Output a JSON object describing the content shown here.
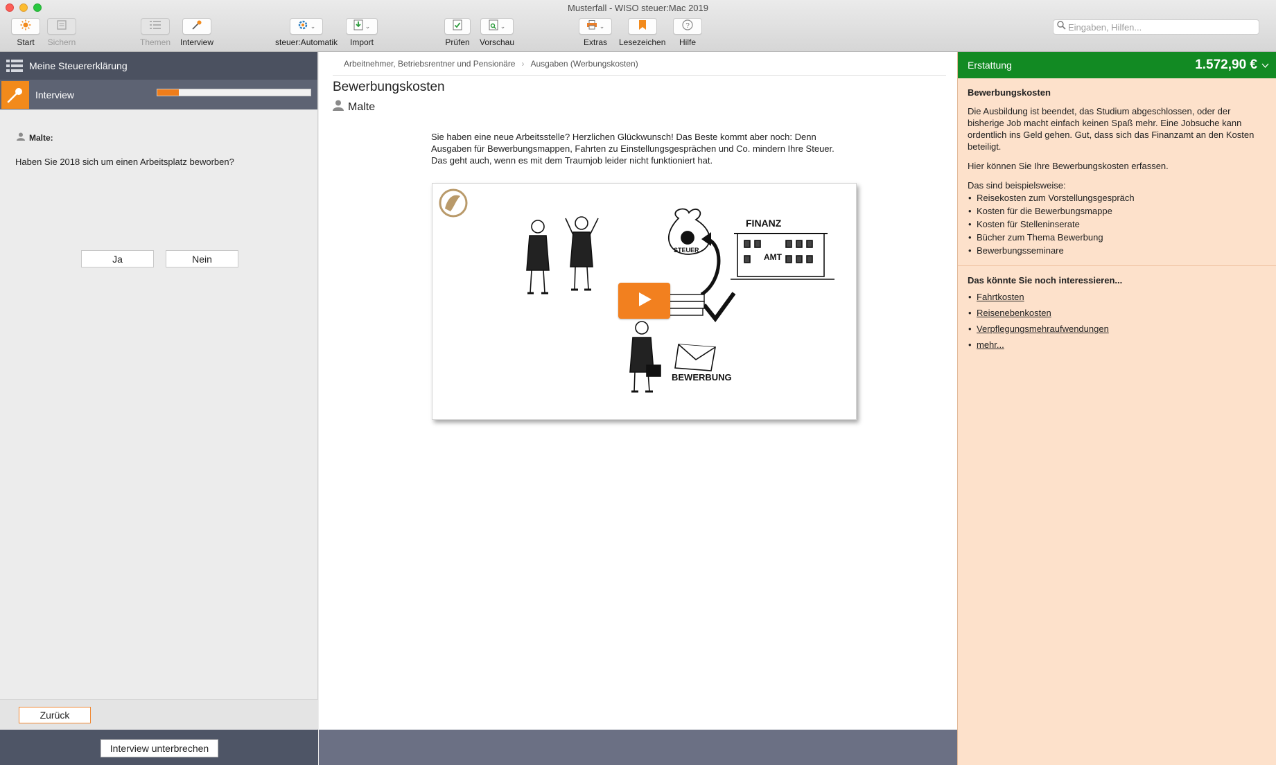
{
  "window": {
    "title": "Musterfall - WISO steuer:Mac 2019"
  },
  "toolbar": {
    "start": "Start",
    "sichern": "Sichern",
    "themen": "Themen",
    "interview": "Interview",
    "automatik": "steuer:Automatik",
    "import": "Import",
    "pruefen": "Prüfen",
    "vorschau": "Vorschau",
    "extras": "Extras",
    "lesezeichen": "Lesezeichen",
    "hilfe": "Hilfe",
    "search_placeholder": "Eingaben, Hilfen..."
  },
  "sidebar": {
    "header": "Meine Steuererklärung",
    "interview_label": "Interview",
    "progress": 0.14,
    "person": "Malte:",
    "question": "Haben Sie 2018 sich um einen Arbeitsplatz beworben?",
    "yes": "Ja",
    "no": "Nein",
    "back": "Zurück",
    "interrupt": "Interview unterbrechen"
  },
  "main": {
    "breadcrumb": [
      "Arbeitnehmer, Betriebsrentner und Pensionäre",
      "Ausgaben (Werbungskosten)"
    ],
    "title": "Bewerbungskosten",
    "person": "Malte",
    "intro": "Sie haben eine neue Arbeitsstelle? Herzlichen Glückwunsch! Das Beste kommt aber noch: Denn Ausgaben für Bewerbungsmappen, Fahrten zu Einstellungsgesprächen und Co. mindern Ihre Steuer. Das geht auch, wenn es mit dem Traumjob leider nicht funktioniert hat.",
    "video": {
      "building_label": "FINANZ",
      "amt_label": "AMT",
      "bag_label": "STEUER",
      "envelope_label": "BEWERBUNG"
    }
  },
  "right": {
    "refund_label": "Erstattung",
    "refund_amount": "1.572,90 €",
    "section_title": "Bewerbungskosten",
    "para1": "Die Ausbildung ist beendet, das Studium abgeschlossen, oder der bisherige Job macht einfach keinen Spaß mehr. Eine Jobsuche kann ordentlich ins Geld gehen. Gut, dass sich das Finanzamt an den Kosten beteiligt.",
    "para2": "Hier können Sie Ihre Bewerbungskosten erfassen.",
    "examples_title": "Das sind beispielsweise:",
    "examples": [
      "Reisekosten zum Vorstellungsgespräch",
      "Kosten für die Bewerbungsmappe",
      "Kosten für Stelleninserate",
      "Bücher zum Thema Bewerbung",
      "Bewerbungsseminare"
    ],
    "more_title": "Das könnte Sie noch interessieren...",
    "links": [
      "Fahrtkosten",
      "Reisenebenkosten",
      "Verpflegungsmehraufwendungen",
      "mehr..."
    ]
  },
  "colors": {
    "accent": "#ef7d1a",
    "refund_green": "#128a23",
    "sidebar_dark": "#4b5160",
    "right_panel_bg": "#fde1cb"
  }
}
